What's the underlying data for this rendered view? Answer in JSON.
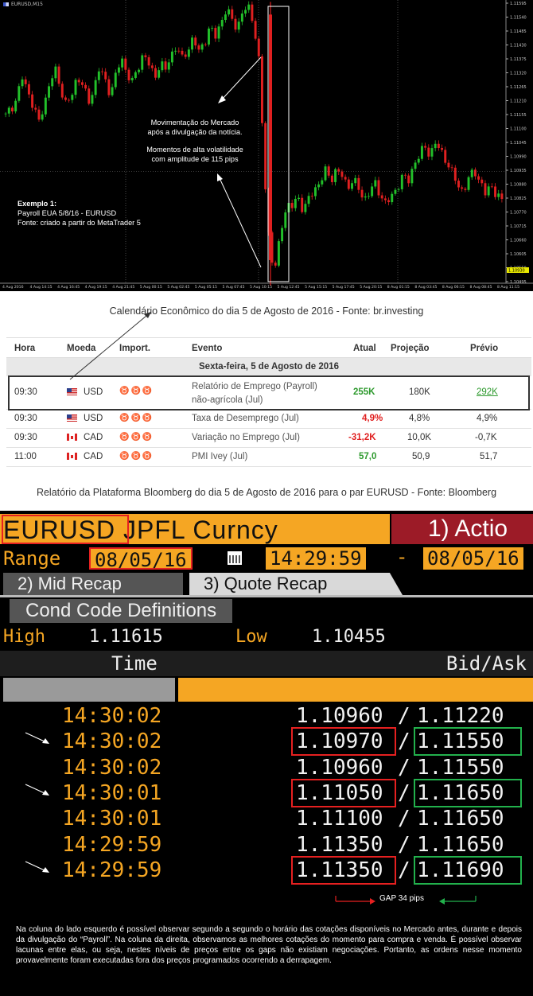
{
  "chart": {
    "window_title": "EURUSD,M15",
    "annotation_center_1": "Movimentação do Mercado",
    "annotation_center_2": "após a divulgação da notícia.",
    "annotation_center_3": "Momentos de alta volatilidade",
    "annotation_center_4": "com amplitude de 115 pips",
    "example_title": "Exemplo 1:",
    "example_line1": "Payroll EUA 5/8/16 - EURUSD",
    "example_line2": "Fonte: criado a partir do MetaTrader 5",
    "current_price_label": "1.10930",
    "colors": {
      "bull": "#22c02a",
      "bear": "#e02020",
      "background": "#000000"
    }
  },
  "chart_data": {
    "type": "candlestick",
    "y_ticks": [
      "1.11595",
      "1.11540",
      "1.11485",
      "1.11430",
      "1.11375",
      "1.11320",
      "1.11265",
      "1.11210",
      "1.11155",
      "1.11100",
      "1.11045",
      "1.10990",
      "1.10935",
      "1.10880",
      "1.10825",
      "1.10770",
      "1.10715",
      "1.10660",
      "1.10605",
      "1.10550",
      "1.10495"
    ],
    "x_ticks": [
      "4 Aug 2016",
      "4 Aug 14:15",
      "4 Aug 16:45",
      "4 Aug 19:15",
      "4 Aug 21:45",
      "5 Aug 00:15",
      "5 Aug 02:45",
      "5 Aug 05:15",
      "5 Aug 07:45",
      "5 Aug 10:15",
      "5 Aug 12:45",
      "5 Aug 15:15",
      "5 Aug 17:45",
      "5 Aug 20:15",
      "8 Aug 01:15",
      "8 Aug 03:45",
      "8 Aug 06:15",
      "8 Aug 08:45",
      "8 Aug 11:15"
    ],
    "ylim": [
      1.10495,
      1.11595
    ],
    "close_path": [
      1.1115,
      1.1118,
      1.1122,
      1.113,
      1.1125,
      1.1119,
      1.1112,
      1.112,
      1.1128,
      1.1133,
      1.1126,
      1.1119,
      1.1123,
      1.1131,
      1.1127,
      1.112,
      1.1126,
      1.1134,
      1.1129,
      1.1124,
      1.1131,
      1.1138,
      1.1132,
      1.1128,
      1.1134,
      1.114,
      1.1135,
      1.113,
      1.1136,
      1.1133,
      1.1139,
      1.1143,
      1.1137,
      1.1141,
      1.1146,
      1.114,
      1.1144,
      1.115,
      1.1146,
      1.1152,
      1.1157,
      1.1153,
      1.115,
      1.1156,
      1.1158,
      1.1152,
      1.1135,
      1.109,
      1.106,
      1.1055,
      1.1071,
      1.108,
      1.1079,
      1.1083,
      1.1078,
      1.1082,
      1.1086,
      1.1089,
      1.1093,
      1.109,
      1.1094,
      1.1091,
      1.1087,
      1.109,
      1.1086,
      1.1082,
      1.1085,
      1.1088,
      1.1084,
      1.108,
      1.1083,
      1.1087,
      1.1091,
      1.1089,
      1.1096,
      1.1099,
      1.1103,
      1.11,
      1.1104,
      1.1101,
      1.1097,
      1.1092,
      1.1088,
      1.1085,
      1.109,
      1.1094,
      1.1089,
      1.1084,
      1.1088,
      1.1084,
      1.1081
    ]
  },
  "captions": {
    "calendar": "Calendário Econômico do dia 5 de Agosto de 2016 - Fonte: br.investing",
    "bloomberg": "Relatório da Plataforma Bloomberg do dia 5 de Agosto de 2016 para o par EURUSD - Fonte: Bloomberg"
  },
  "calendar": {
    "headers": {
      "hora": "Hora",
      "moeda": "Moeda",
      "import": "Import.",
      "evento": "Evento",
      "atual": "Atual",
      "projecao": "Projeção",
      "previo": "Prévio"
    },
    "section": "Sexta-feira, 5 de Agosto de 2016",
    "rows": [
      {
        "hora": "09:30",
        "moeda": "USD",
        "flag": "us",
        "evento1": "Relatório de Emprego (Payroll)",
        "evento2": "não-agrícola (Jul)",
        "atual": "255K",
        "atual_class": "pos",
        "projecao": "180K",
        "previo": "292K",
        "previo_class": "link"
      },
      {
        "hora": "09:30",
        "moeda": "USD",
        "flag": "us",
        "evento1": "Taxa de Desemprego (Jul)",
        "evento2": "",
        "atual": "4,9%",
        "atual_class": "neg",
        "projecao": "4,8%",
        "previo": "4,9%",
        "previo_class": ""
      },
      {
        "hora": "09:30",
        "moeda": "CAD",
        "flag": "ca",
        "evento1": "Variação no Emprego (Jul)",
        "evento2": "",
        "atual": "-31,2K",
        "atual_class": "neg",
        "projecao": "10,0K",
        "previo": "-0,7K",
        "previo_class": ""
      },
      {
        "hora": "11:00",
        "moeda": "CAD",
        "flag": "ca",
        "evento1": "PMI Ivey (Jul)",
        "evento2": "",
        "atual": "57,0",
        "atual_class": "pos",
        "projecao": "50,9",
        "previo": "51,7",
        "previo_class": ""
      }
    ]
  },
  "bloomberg": {
    "pair": "EURUSD JPFL Curncy",
    "actions": "1) Actio",
    "range_label": "Range",
    "date_from": "08/05/16",
    "time_from": "14:29:59",
    "dash": "-",
    "date_to": "08/05/16",
    "tab_mid": "2) Mid Recap",
    "tab_quote": "3) Quote Recap",
    "cond_code": "Cond Code Definitions",
    "high_label": "High",
    "high_value": "1.11615",
    "low_label": "Low",
    "low_value": "1.10455",
    "col_time": "Time",
    "col_bidask": "Bid/Ask",
    "rows": [
      {
        "time": "14:30:02",
        "bid": "1.10960",
        "ask": "1.11220",
        "boxed": false,
        "arrow": false
      },
      {
        "time": "14:30:02",
        "bid": "1.10970",
        "ask": "1.11550",
        "boxed": true,
        "arrow": true
      },
      {
        "time": "14:30:02",
        "bid": "1.10960",
        "ask": "1.11550",
        "boxed": false,
        "arrow": false
      },
      {
        "time": "14:30:01",
        "bid": "1.11050",
        "ask": "1.11650",
        "boxed": true,
        "arrow": true
      },
      {
        "time": "14:30:01",
        "bid": "1.11100",
        "ask": "1.11650",
        "boxed": false,
        "arrow": false
      },
      {
        "time": "14:29:59",
        "bid": "1.11350",
        "ask": "1.11650",
        "boxed": false,
        "arrow": false
      },
      {
        "time": "14:29:59",
        "bid": "1.11350",
        "ask": "1.11690",
        "boxed": true,
        "arrow": true
      }
    ],
    "gap_label": "GAP 34 pips",
    "note": "Na coluna do lado esquerdo é possível observar segundo a segundo o horário das cotações disponíveis no Mercado antes, durante e depois da divulgação do “Payroll”. Na coluna da direita, observamos as melhores cotações do momento para compra e venda. É possível observar lacunas entre elas, ou seja, nestes níveis de preços entre os gaps não existiam negociações. Portanto, as ordens nesse momento provavelmente foram executadas fora dos preços programados ocorrendo a derrapagem."
  }
}
